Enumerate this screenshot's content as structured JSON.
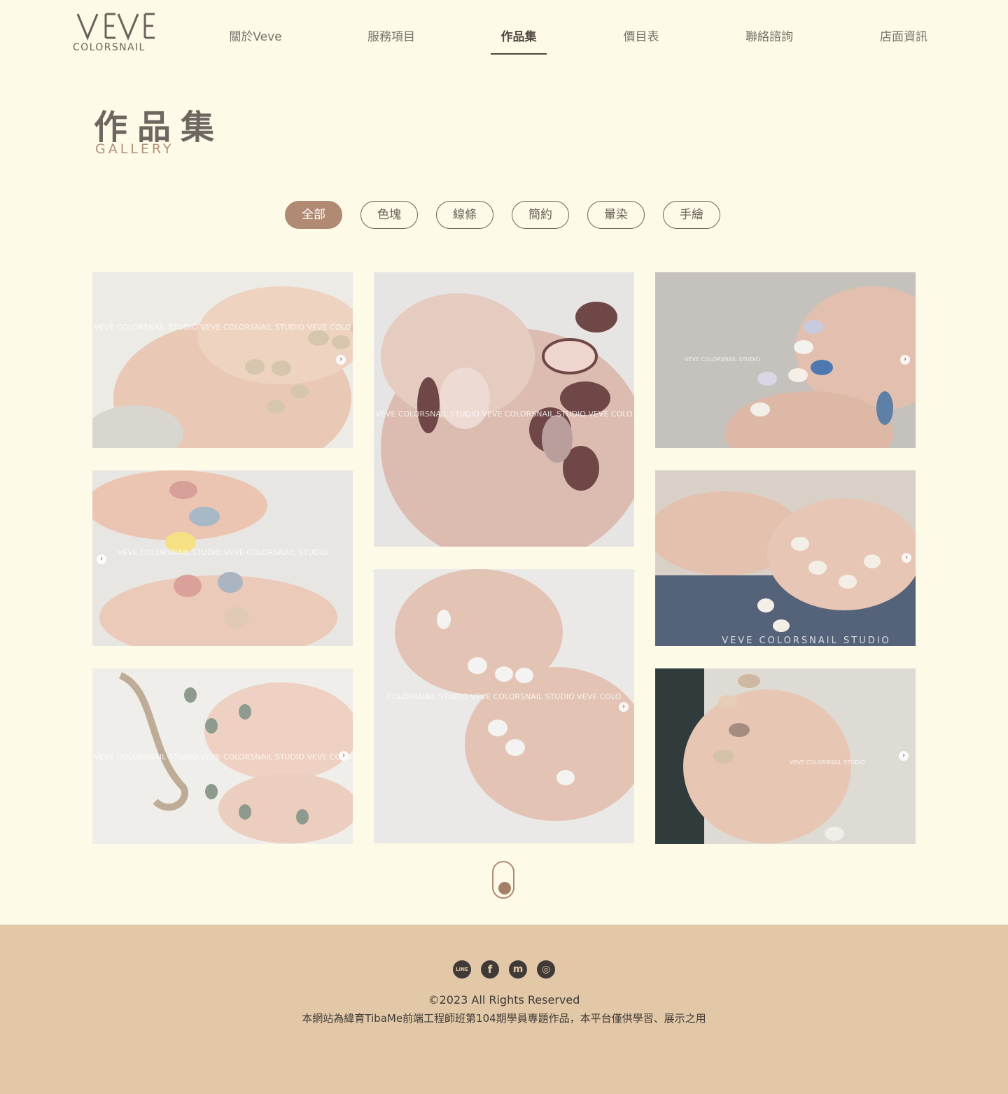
{
  "brand": {
    "logo_mark": "VEVE",
    "logo_sub": "COLORSNAIL"
  },
  "nav": {
    "items": [
      {
        "label": "關於Veve"
      },
      {
        "label": "服務項目"
      },
      {
        "label": "作品集",
        "active": true
      },
      {
        "label": "價目表"
      },
      {
        "label": "聯絡諮詢"
      },
      {
        "label": "店面資訊"
      }
    ]
  },
  "page": {
    "title": "作品集",
    "subtitle": "GALLERY"
  },
  "filters": [
    {
      "label": "全部",
      "active": true
    },
    {
      "label": "色塊"
    },
    {
      "label": "線條"
    },
    {
      "label": "簡約"
    },
    {
      "label": "暈染"
    },
    {
      "label": "手繪"
    }
  ],
  "gallery": {
    "items": [
      {
        "watermark": "VEVE COLORSNAIL STUDIO  VEVE COLORSNAIL STUDIO  VEVE COLO"
      },
      {
        "watermark": "VEVE COLORSNAIL STUDIO  VEVE COLORSNAIL STUDIO  VEVE COLO"
      },
      {
        "watermark": "VEVE COLORSNAIL STUDIO"
      },
      {
        "watermark": "VEVE COLORSNAIL STUDIO  VEVE COLORSNAIL STUDIO"
      },
      {
        "watermark": "VEVE COLORSNAIL STUDIO"
      },
      {
        "watermark": "COLORSNAIL STUDIO  VEVE COLORSNAIL STUDIO  VEVE COLO"
      },
      {
        "watermark": "VEVE COLORSNAIL STUDIO  VEVE COLORSNAIL STUDIO  VEVE COLO"
      },
      {
        "watermark": "VEVE COLORSNAIL STUDIO"
      }
    ]
  },
  "footer": {
    "social_icons": [
      "line-icon",
      "facebook-icon",
      "messenger-icon",
      "instagram-icon"
    ],
    "social_glyphs": [
      "LINE",
      "f",
      "m",
      "◎"
    ],
    "copyright": "©2023 All Rights Reserved",
    "disclaimer": "本網站為緯育TibaMe前端工程師班第104期學員專題作品，本平台僅供學習、展示之用"
  },
  "colors": {
    "background": "#fdfbe7",
    "accent": "#b08a73",
    "footer": "#e2c8a7",
    "text": "#6b635b"
  }
}
